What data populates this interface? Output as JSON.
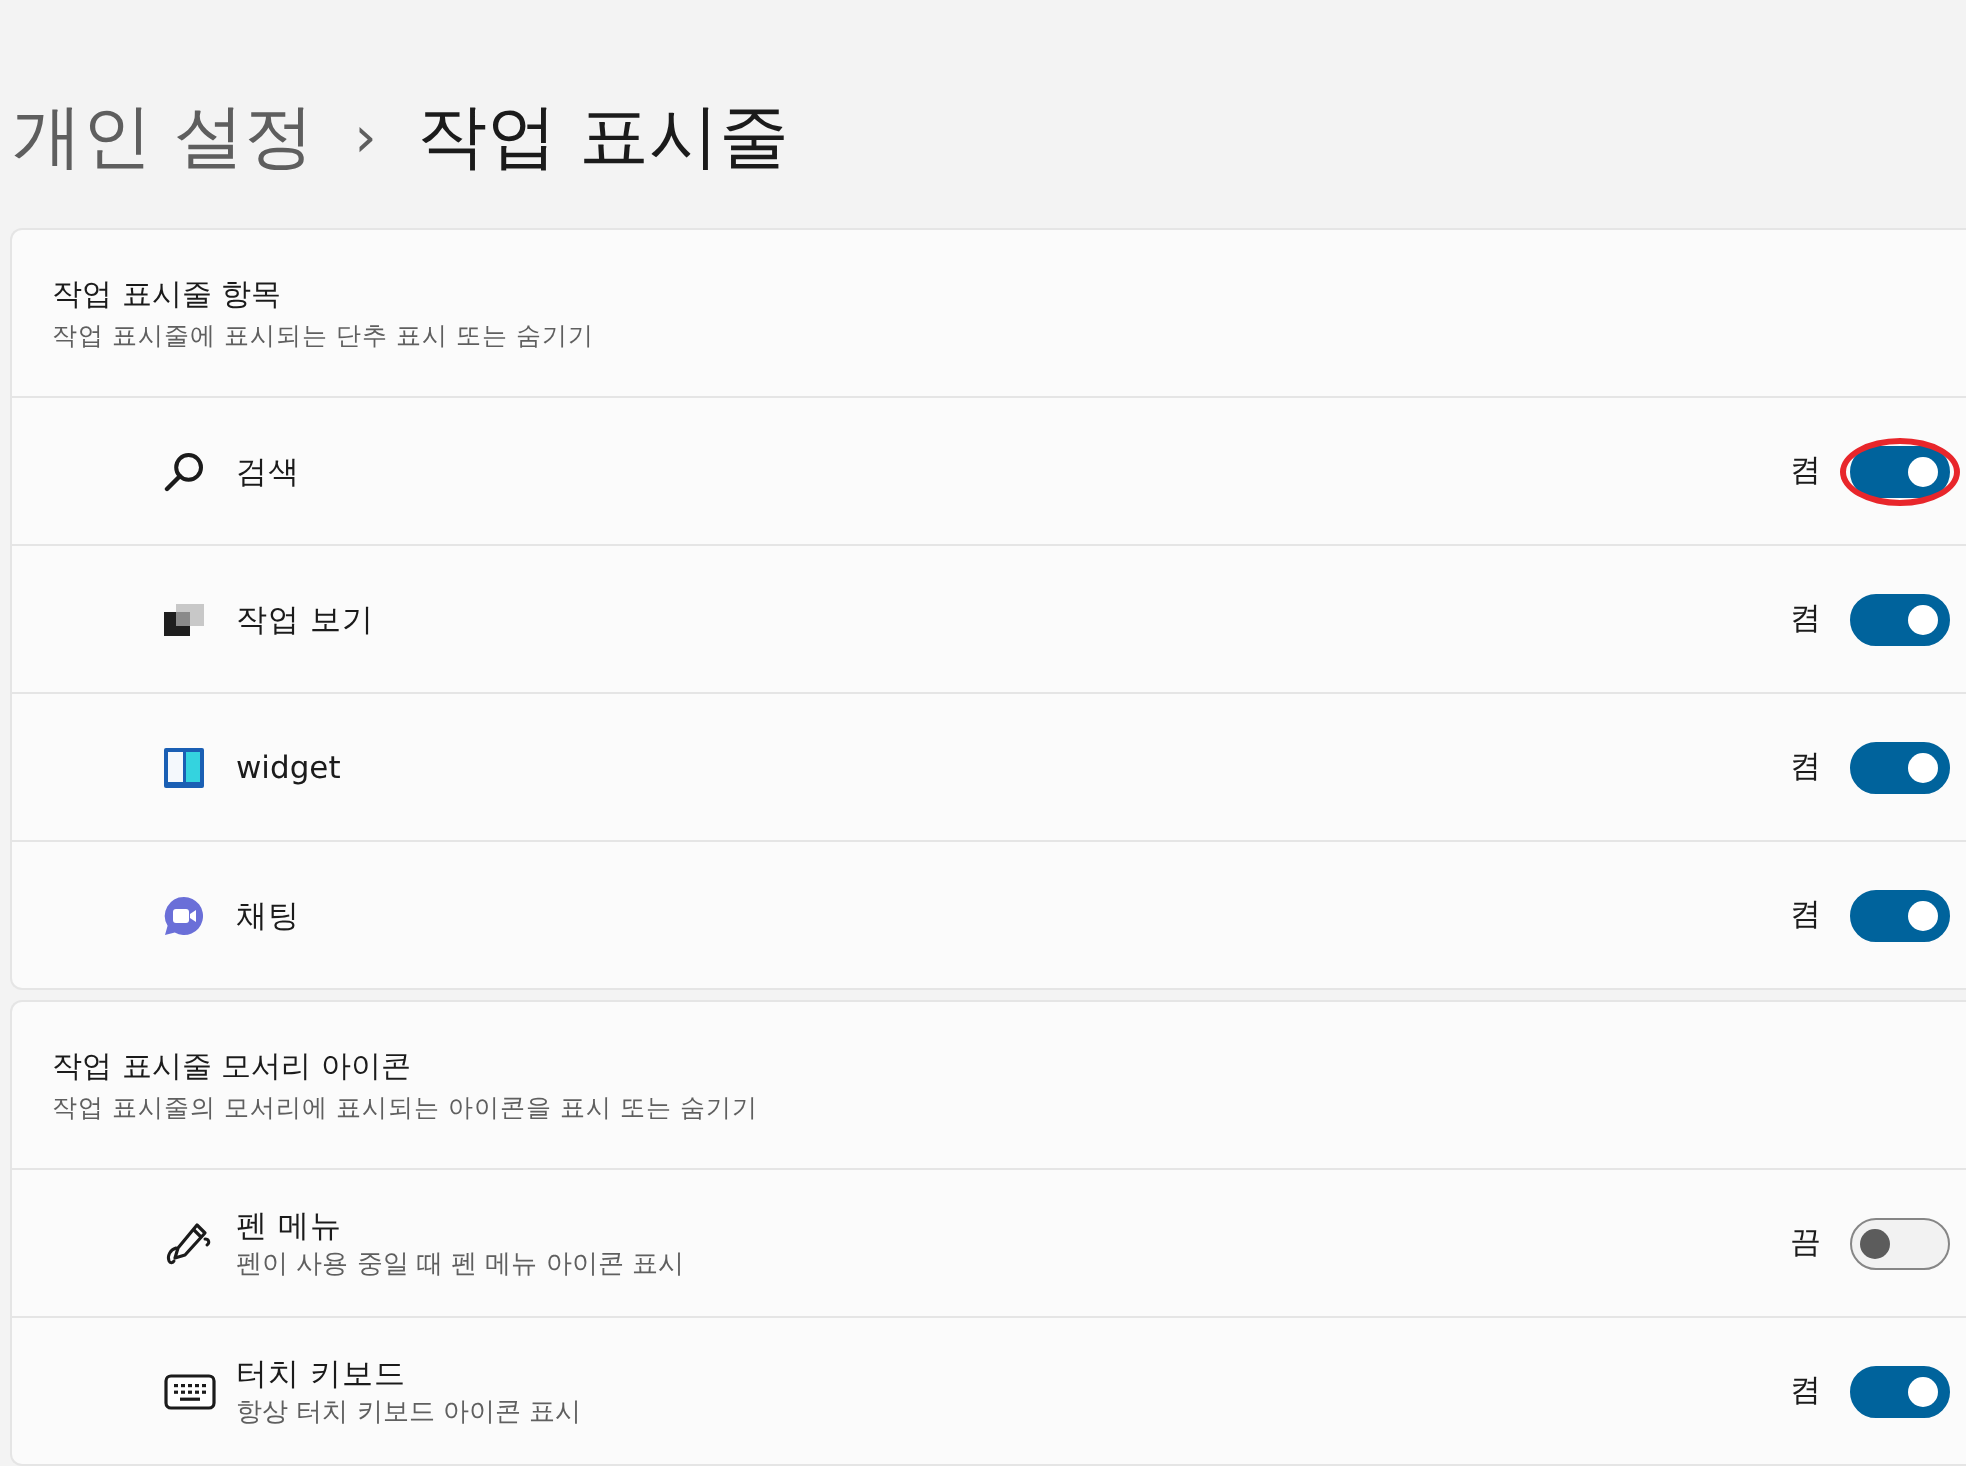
{
  "breadcrumb": {
    "parent": "개인 설정",
    "separator": "›",
    "current": "작업 표시줄"
  },
  "sections": [
    {
      "title": "작업 표시줄 항목",
      "subtitle": "작업 표시줄에 표시되는 단추 표시 또는 숨기기",
      "items": [
        {
          "kind": "search",
          "label": "검색",
          "state_label": "켬",
          "on": true,
          "highlighted": true
        },
        {
          "kind": "task-view",
          "label": "작업 보기",
          "state_label": "켬",
          "on": true,
          "highlighted": false
        },
        {
          "kind": "widgets",
          "label": "widget",
          "state_label": "켬",
          "on": true,
          "highlighted": false
        },
        {
          "kind": "chat",
          "label": "채팅",
          "state_label": "켬",
          "on": true,
          "highlighted": false
        }
      ]
    },
    {
      "title": "작업 표시줄 모서리 아이콘",
      "subtitle": "작업 표시줄의 모서리에 표시되는 아이콘을 표시 또는 숨기기",
      "items": [
        {
          "kind": "pen",
          "label": "펜 메뉴",
          "description": "펜이 사용 중일 때 펜 메뉴 아이콘 표시",
          "state_label": "끔",
          "on": false,
          "highlighted": false
        },
        {
          "kind": "keyboard",
          "label": "터치 키보드",
          "description": "항상 터치 키보드 아이콘 표시",
          "state_label": "켬",
          "on": true,
          "highlighted": false
        }
      ]
    }
  ]
}
